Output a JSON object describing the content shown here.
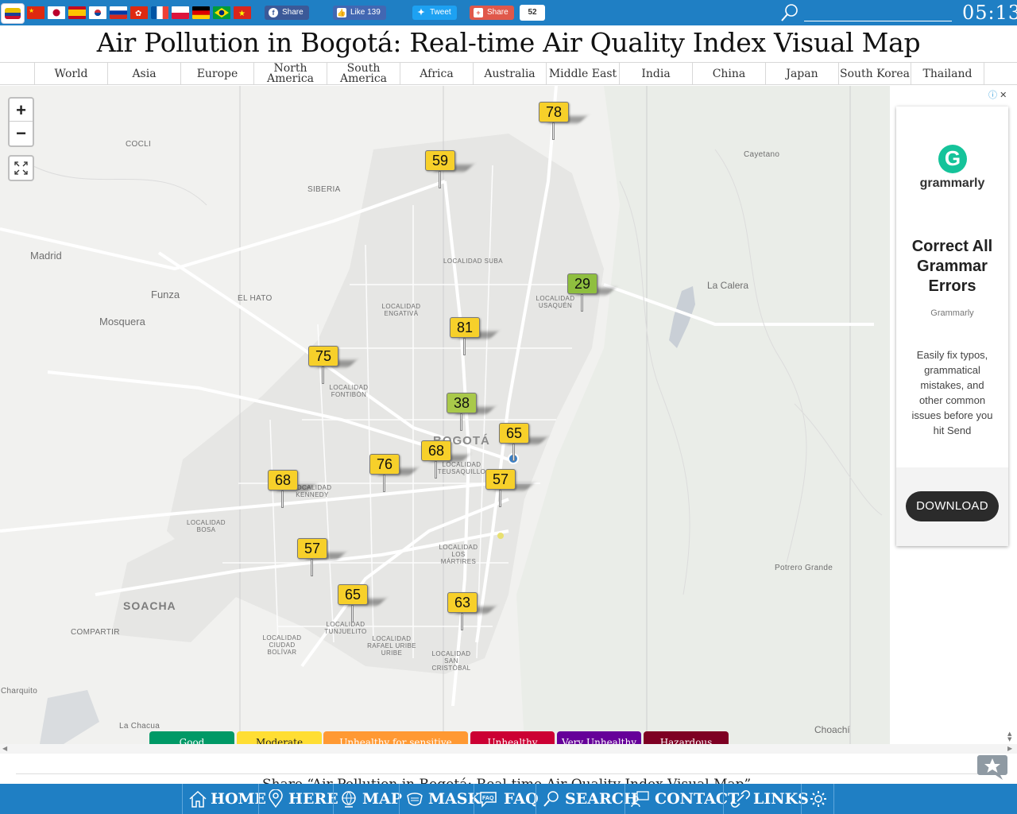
{
  "topbar": {
    "flags": [
      "china",
      "japan",
      "spain",
      "south-korea",
      "russia",
      "hong-kong",
      "france",
      "poland",
      "germany",
      "brazil",
      "vietnam"
    ],
    "social": {
      "facebook_share": "Share",
      "like_label": "Like 139",
      "tweet_label": "Tweet",
      "share_label": "Share",
      "share_count": "52"
    },
    "search_value": "",
    "clock": "05:13"
  },
  "title": "Air Pollution in Bogotá: Real-time Air Quality Index Visual Map",
  "tabs": [
    "World",
    "Asia",
    "Europe",
    "North America",
    "South America",
    "Africa",
    "Australia",
    "Middle East",
    "India",
    "China",
    "Japan",
    "South Korea",
    "Thailand"
  ],
  "map": {
    "zoom_in": "+",
    "zoom_out": "−",
    "places": {
      "cocli": "COCLI",
      "siberia": "SIBERIA",
      "madrid": "Madrid",
      "funza": "Funza",
      "mosquera": "Mosquera",
      "el_hato": "EL HATO",
      "la_calera": "La Calera",
      "cayetano": "Cayetano",
      "suba": "LOCALIDAD SUBA",
      "engativa": "LOCALIDAD ENGATIVÁ",
      "usaquen": "LOCALIDAD USAQUÉN",
      "fontibon": "LOCALIDAD FONTIBÓN",
      "bogota": "BOGOTÁ",
      "teusaquillo": "LOCALIDAD TEUSAQUILLO",
      "kennedy": "LOCALIDAD KENNEDY",
      "bosa": "LOCALIDAD BOSA",
      "martires": "LOCALIDAD LOS MÁRTIRES",
      "soacha": "SOACHA",
      "compartir": "COMPARTIR",
      "tunjuelito": "LOCALIDAD TUNJUELITO",
      "ciudad_bolivar": "LOCALIDAD CIUDAD BOLÍVAR",
      "rafael_uribe": "LOCALIDAD RAFAEL URIBE URIBE",
      "san_cristobal": "LOCALIDAD SAN CRISTÓBAL",
      "potrero_grande": "Potrero Grande",
      "charquito": "Charquito",
      "la_chacua": "La Chacua",
      "choachi": "Choachí"
    },
    "stations": [
      {
        "aqi": "78",
        "color": "#f7d02a"
      },
      {
        "aqi": "59",
        "color": "#f7d02a"
      },
      {
        "aqi": "29",
        "color": "#8fbf3f"
      },
      {
        "aqi": "81",
        "color": "#f7d02a"
      },
      {
        "aqi": "75",
        "color": "#f7d02a"
      },
      {
        "aqi": "38",
        "color": "#a9c94a"
      },
      {
        "aqi": "65",
        "color": "#f7d02a"
      },
      {
        "aqi": "68",
        "color": "#f7d02a"
      },
      {
        "aqi": "76",
        "color": "#f7d02a"
      },
      {
        "aqi": "68",
        "color": "#f7d02a"
      },
      {
        "aqi": "57",
        "color": "#f7d02a"
      },
      {
        "aqi": "57",
        "color": "#f7d02a"
      },
      {
        "aqi": "65",
        "color": "#f7d02a"
      },
      {
        "aqi": "63",
        "color": "#f7d02a"
      }
    ],
    "legend": [
      {
        "label": "Good",
        "color": "#009966"
      },
      {
        "label": "Moderate",
        "color": "#ffde33"
      },
      {
        "label": "Unhealthy for sensitive groups",
        "color": "#ff9933"
      },
      {
        "label": "Unhealthy",
        "color": "#cc0033"
      },
      {
        "label": "Very Unhealthy",
        "color": "#660099"
      },
      {
        "label": "Hazardous",
        "color": "#7e0023"
      }
    ]
  },
  "ad": {
    "brand": "grammarly",
    "logo_letter": "G",
    "headline": "Correct All Grammar Errors",
    "sponsor": "Grammarly",
    "body": "Easily fix typos, grammatical mistakes, and other common issues before you hit Send",
    "cta": "DOWNLOAD"
  },
  "share_text": "Share “Air Pollution in Bogotá: Real-time Air Quality Index Visual Map”",
  "bottom_nav": [
    "HOME",
    "HERE",
    "MAP",
    "MASK",
    "FAQ",
    "SEARCH",
    "CONTACT",
    "LINKS"
  ]
}
